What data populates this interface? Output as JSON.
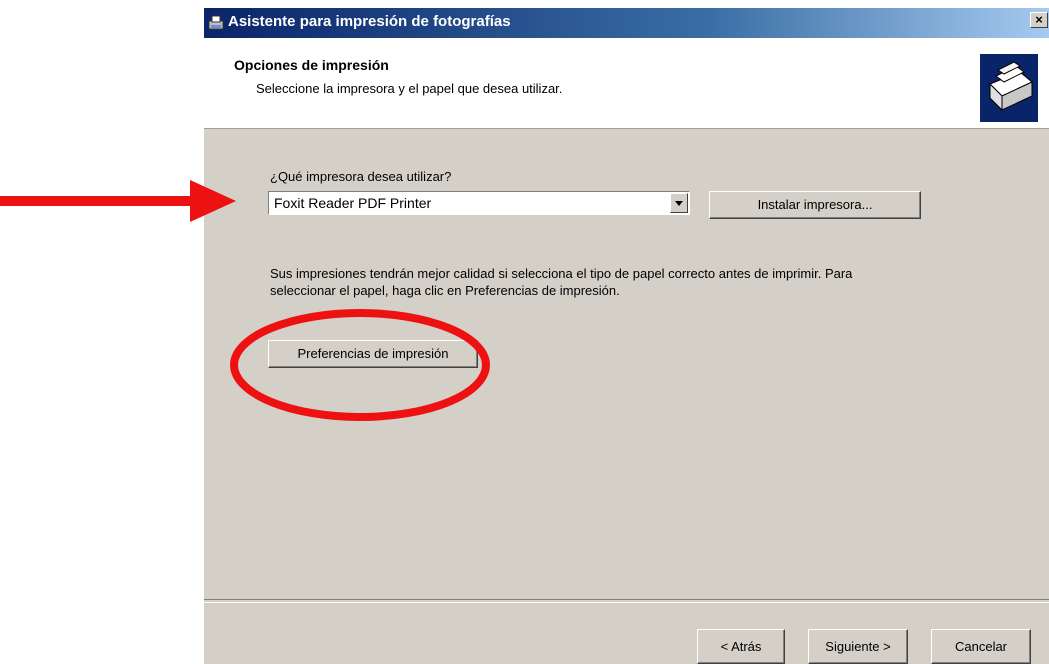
{
  "window": {
    "title": "Asistente para impresión de fotografías",
    "close_glyph": "×"
  },
  "header": {
    "title": "Opciones de impresión",
    "subtitle": "Seleccione la impresora y el papel que desea utilizar."
  },
  "printer": {
    "question": "¿Qué impresora desea utilizar?",
    "selected": "Foxit Reader PDF Printer",
    "install_label": "Instalar impresora..."
  },
  "paper": {
    "info": "Sus impresiones tendrán mejor calidad si selecciona el tipo de papel correcto antes de imprimir. Para seleccionar el papel, haga clic en Preferencias de impresión.",
    "preferences_label": "Preferencias de impresión"
  },
  "footer": {
    "back_label": "< Atrás",
    "next_label": "Siguiente >",
    "cancel_label": "Cancelar"
  },
  "annotations": {
    "arrow_color": "#ee1111",
    "circle_color": "#ee1111"
  },
  "icons": {
    "title_icon": "printer-wizard-icon",
    "header_icon": "printer-photos-icon",
    "dropdown_icon": "chevron-down-icon"
  }
}
